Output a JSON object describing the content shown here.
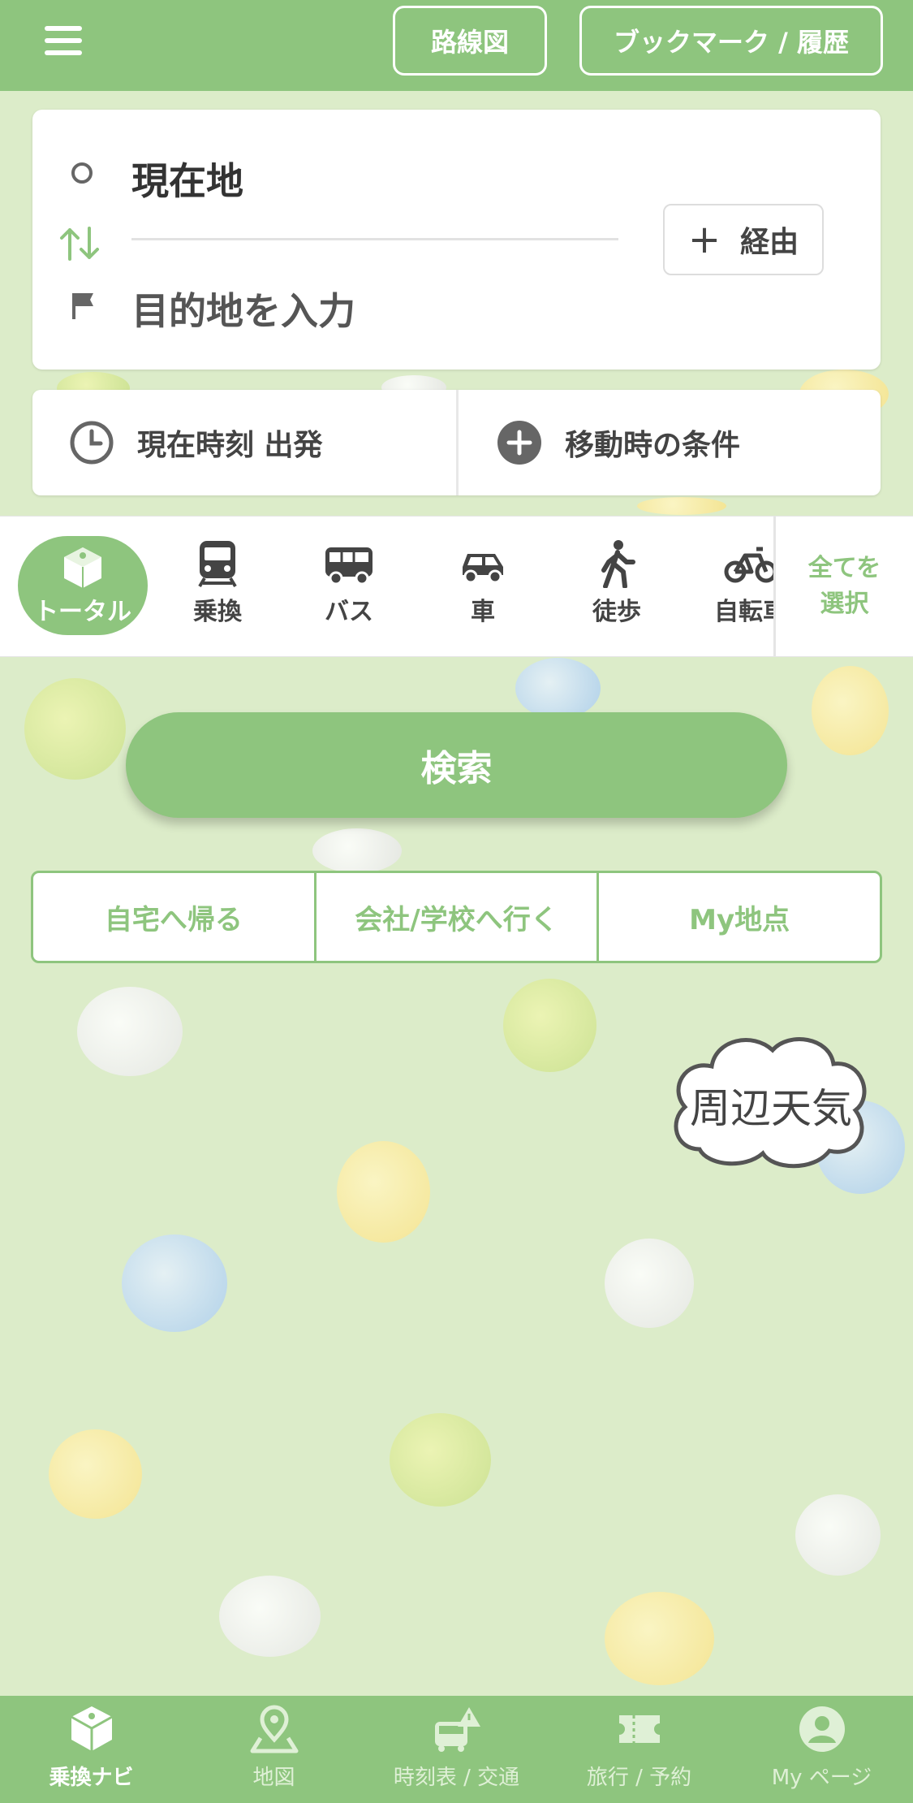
{
  "header": {
    "route_map_label": "路線図",
    "bookmark_label": "ブックマーク / 履歴",
    "menu_icon": "hamburger-icon"
  },
  "route": {
    "origin": "現在地",
    "destination_placeholder": "目的地を入力",
    "via_label": "経由"
  },
  "options": {
    "time_label": "現在時刻 出発",
    "conditions_label": "移動時の条件"
  },
  "modes": {
    "items": [
      {
        "label": "トータル",
        "icon": "total-icon",
        "selected": true
      },
      {
        "label": "乗換",
        "icon": "train-icon"
      },
      {
        "label": "バス",
        "icon": "bus-icon"
      },
      {
        "label": "車",
        "icon": "car-icon"
      },
      {
        "label": "徒歩",
        "icon": "walk-icon"
      },
      {
        "label": "自転車",
        "icon": "bicycle-icon"
      }
    ],
    "select_all_line1": "全てを",
    "select_all_line2": "選択"
  },
  "search_label": "検索",
  "shortcuts": [
    "自宅へ帰る",
    "会社/学校へ行く",
    "My地点"
  ],
  "weather_label": "周辺天気",
  "nav": [
    {
      "label": "乗換ナビ",
      "icon": "total-icon",
      "active": true
    },
    {
      "label": "地図",
      "icon": "map-pin-icon"
    },
    {
      "label": "時刻表 / 交通",
      "icon": "timetable-icon"
    },
    {
      "label": "旅行 / 予約",
      "icon": "ticket-icon"
    },
    {
      "label": "My ページ",
      "icon": "user-icon"
    }
  ],
  "colors": {
    "accent": "#8ec57e",
    "background": "#dcecc9"
  }
}
